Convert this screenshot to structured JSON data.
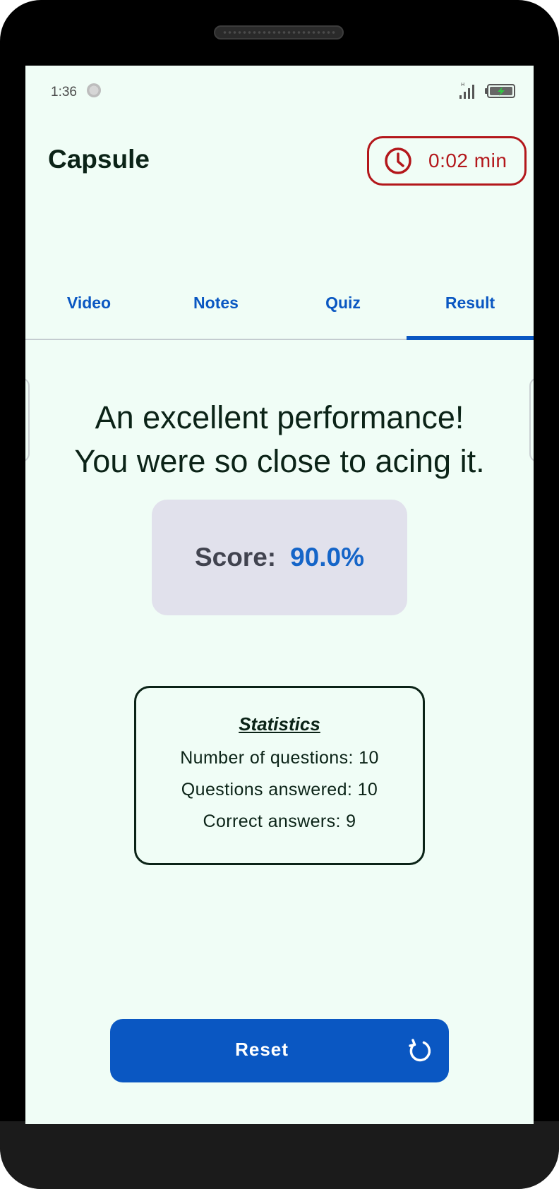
{
  "status_bar": {
    "time": "1:36"
  },
  "app_bar": {
    "title": "Capsule",
    "timer": "0:02 min",
    "timer_color": "#b3171b"
  },
  "tabs": [
    {
      "label": "Video",
      "active": false
    },
    {
      "label": "Notes",
      "active": false
    },
    {
      "label": "Quiz",
      "active": false
    },
    {
      "label": "Result",
      "active": true
    }
  ],
  "result": {
    "headline_line1": "An excellent performance!",
    "headline_line2": "You were so close to acing it.",
    "score_label": "Score:",
    "score_value": "90.0%"
  },
  "statistics": {
    "title": "Statistics",
    "lines": [
      "Number of questions: 10",
      "Questions answered: 10",
      "Correct answers: 9"
    ]
  },
  "reset_button": {
    "label": "Reset",
    "icon": "refresh-icon"
  },
  "colors": {
    "accent": "#0a57c2",
    "background": "#f0fdf6",
    "score_card": "#e1e1ec"
  }
}
